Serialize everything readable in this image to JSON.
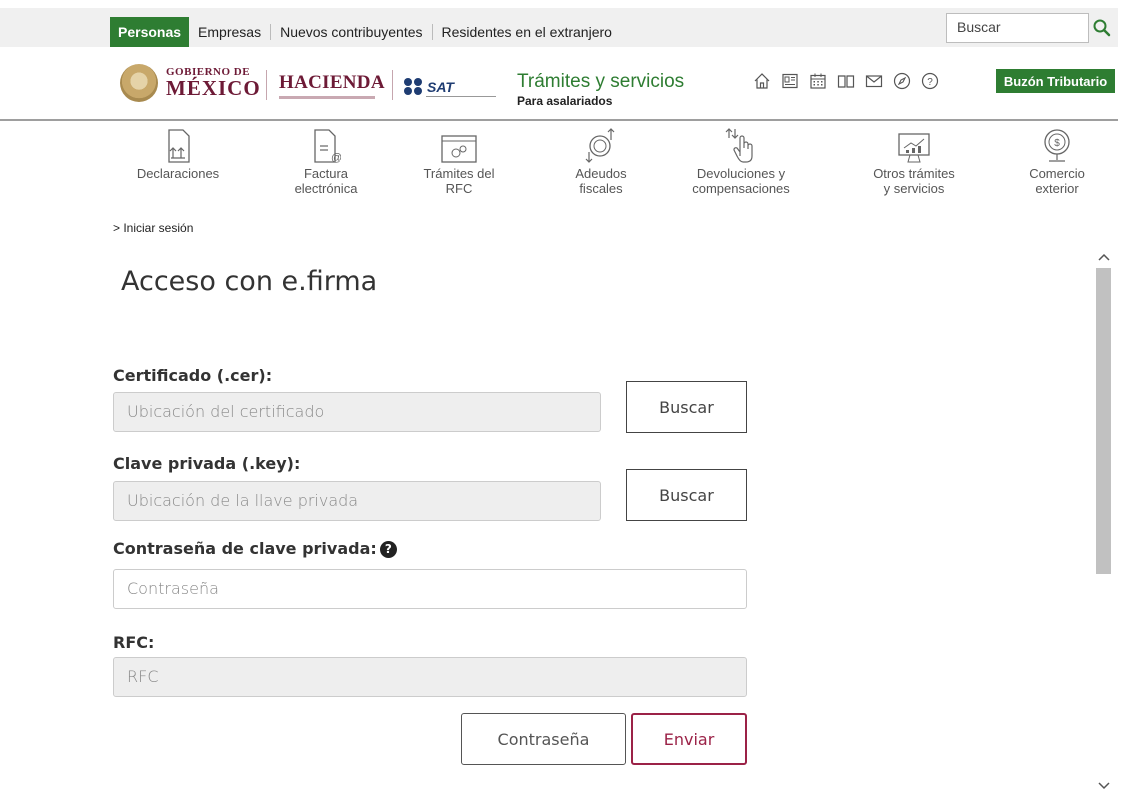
{
  "topnav": {
    "items": [
      "Personas",
      "Empresas",
      "Nuevos contribuyentes",
      "Residentes en el extranjero"
    ],
    "search_placeholder": "Buscar"
  },
  "header": {
    "gobierno_line1": "GOBIERNO DE",
    "gobierno_line2": "MÉXICO",
    "hacienda": "HACIENDA",
    "sat": "SAT",
    "title": "Trámites y servicios",
    "subtitle": "Para asalariados",
    "buzon": "Buzón Tributario",
    "icons": [
      "home-icon",
      "news-icon",
      "calendar-icon",
      "book-icon",
      "mail-icon",
      "compass-icon",
      "help-icon"
    ]
  },
  "services": [
    {
      "line1": "Declaraciones",
      "line2": "",
      "icon": "declaraciones-icon"
    },
    {
      "line1": "Factura",
      "line2": "electrónica",
      "icon": "factura-icon"
    },
    {
      "line1": "Trámites del",
      "line2": "RFC",
      "icon": "rfc-icon"
    },
    {
      "line1": "Adeudos",
      "line2": "fiscales",
      "icon": "adeudos-icon"
    },
    {
      "line1": "Devoluciones y",
      "line2": "compensaciones",
      "icon": "devoluciones-icon"
    },
    {
      "line1": "Otros trámites",
      "line2": "y servicios",
      "icon": "otros-icon"
    },
    {
      "line1": "Comercio",
      "line2": "exterior",
      "icon": "comercio-icon"
    }
  ],
  "breadcrumb": "> Iniciar sesión",
  "page_title": "Acceso con e.firma",
  "form": {
    "cer_label": "Certificado (.cer):",
    "cer_placeholder": "Ubicación del certificado",
    "key_label": "Clave privada (.key):",
    "key_placeholder": "Ubicación de la llave privada",
    "buscar_label": "Buscar",
    "password_label": "Contraseña de clave privada:",
    "password_placeholder": "Contraseña",
    "rfc_label": "RFC:",
    "rfc_placeholder": "RFC",
    "contrasena_button": "Contraseña",
    "enviar_button": "Enviar"
  },
  "colors": {
    "green": "#2e7d32",
    "guinda": "#9b2247",
    "gob_red": "#6d1a36"
  }
}
